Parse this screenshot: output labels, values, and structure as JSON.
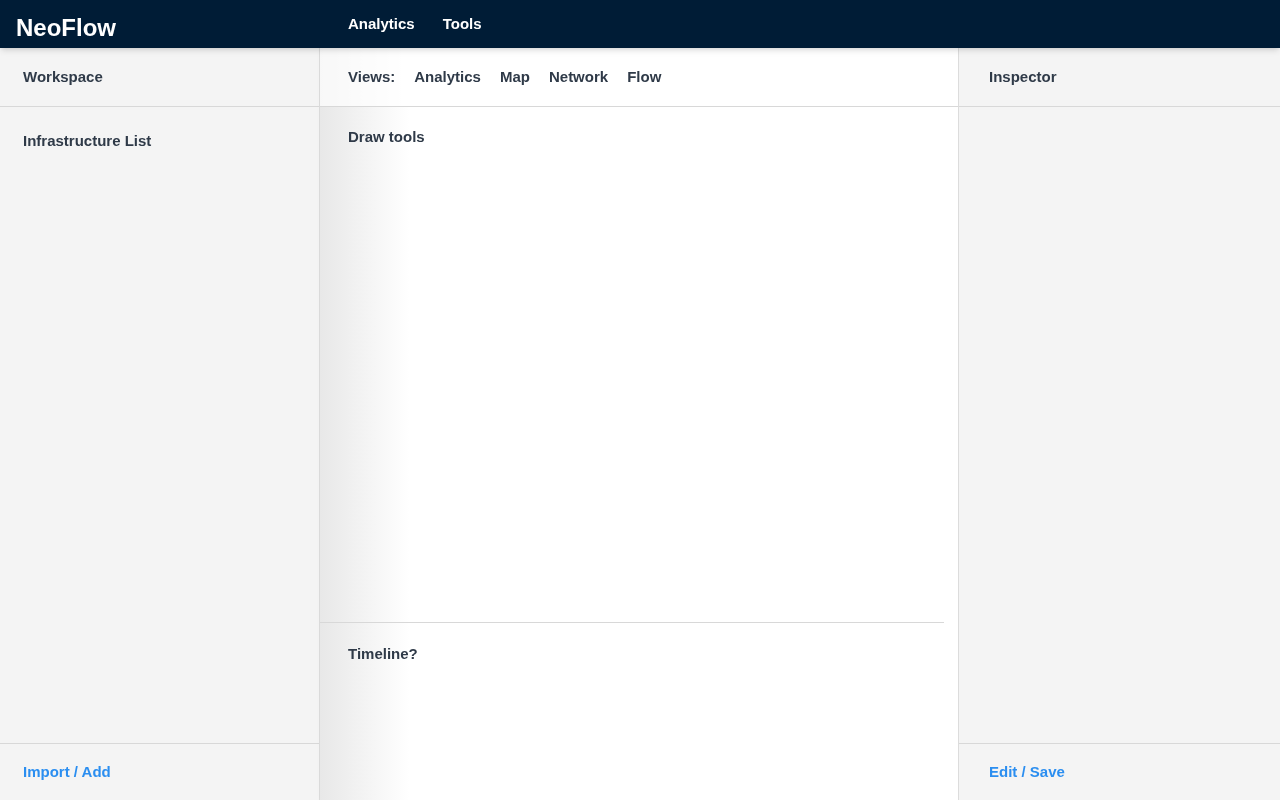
{
  "app": {
    "title": "NeoFlow"
  },
  "nav": [
    "Analytics",
    "Tools"
  ],
  "left_panel": {
    "title": "Workspace",
    "section": "Infrastructure List",
    "footer_action": "Import / Add"
  },
  "views": {
    "label": "Views:",
    "items": [
      "Analytics",
      "Map",
      "Network",
      "Flow"
    ]
  },
  "canvas": {
    "title": "Draw tools"
  },
  "timeline": {
    "title": "Timeline?"
  },
  "right_panel": {
    "title": "Inspector",
    "footer_action": "Edit / Save"
  }
}
